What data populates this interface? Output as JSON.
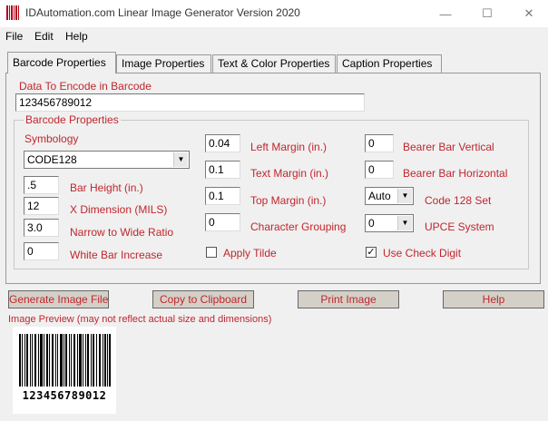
{
  "window": {
    "title": "IDAutomation.com Linear Image Generator Version 2020",
    "minimize_glyph": "—",
    "maximize_glyph": "☐",
    "close_glyph": "✕"
  },
  "menu": {
    "file": "File",
    "edit": "Edit",
    "help": "Help"
  },
  "tabs": [
    "Barcode Properties",
    "Image Properties",
    "Text & Color Properties",
    "Caption Properties"
  ],
  "data_label": "Data To Encode in Barcode",
  "data_value": "123456789012",
  "group_title": "Barcode Properties",
  "symbology": {
    "label": "Symbology",
    "value": "CODE128"
  },
  "left_fields": [
    {
      "value": ".5",
      "label": "Bar Height (in.)"
    },
    {
      "value": "12",
      "label": "X Dimension (MILS)"
    },
    {
      "value": "3.0",
      "label": "Narrow to Wide Ratio"
    },
    {
      "value": "0",
      "label": "White Bar Increase"
    }
  ],
  "middle_fields": [
    {
      "value": "0.04",
      "label": "Left Margin (in.)"
    },
    {
      "value": "0.1",
      "label": "Text Margin (in.)"
    },
    {
      "value": "0.1",
      "label": "Top Margin (in.)"
    },
    {
      "value": "0",
      "label": "Character Grouping"
    }
  ],
  "apply_tilde": {
    "label": "Apply Tilde",
    "checked": false
  },
  "right_fields": [
    {
      "value": "0",
      "label": "Bearer Bar Vertical"
    },
    {
      "value": "0",
      "label": "Bearer Bar Horizontal"
    }
  ],
  "code128_set": {
    "value": "Auto",
    "label": "Code 128 Set"
  },
  "upce_system": {
    "value": "0",
    "label": "UPCE System"
  },
  "use_check_digit": {
    "label": "Use Check Digit",
    "checked": true,
    "check_glyph": "✓"
  },
  "buttons": {
    "generate": "Generate Image File",
    "copy": "Copy to Clipboard",
    "print": "Print Image",
    "help": "Help"
  },
  "preview_label": "Image Preview  (may not reflect actual size and dimensions)",
  "barcode": {
    "text": "123456789012"
  },
  "colors": {
    "label_red": "#c0262d",
    "button_bg": "#d4d0c8",
    "window_bg": "#f0f0f0"
  },
  "icons": {
    "dropdown": "▼",
    "app": "barcode-icon"
  }
}
